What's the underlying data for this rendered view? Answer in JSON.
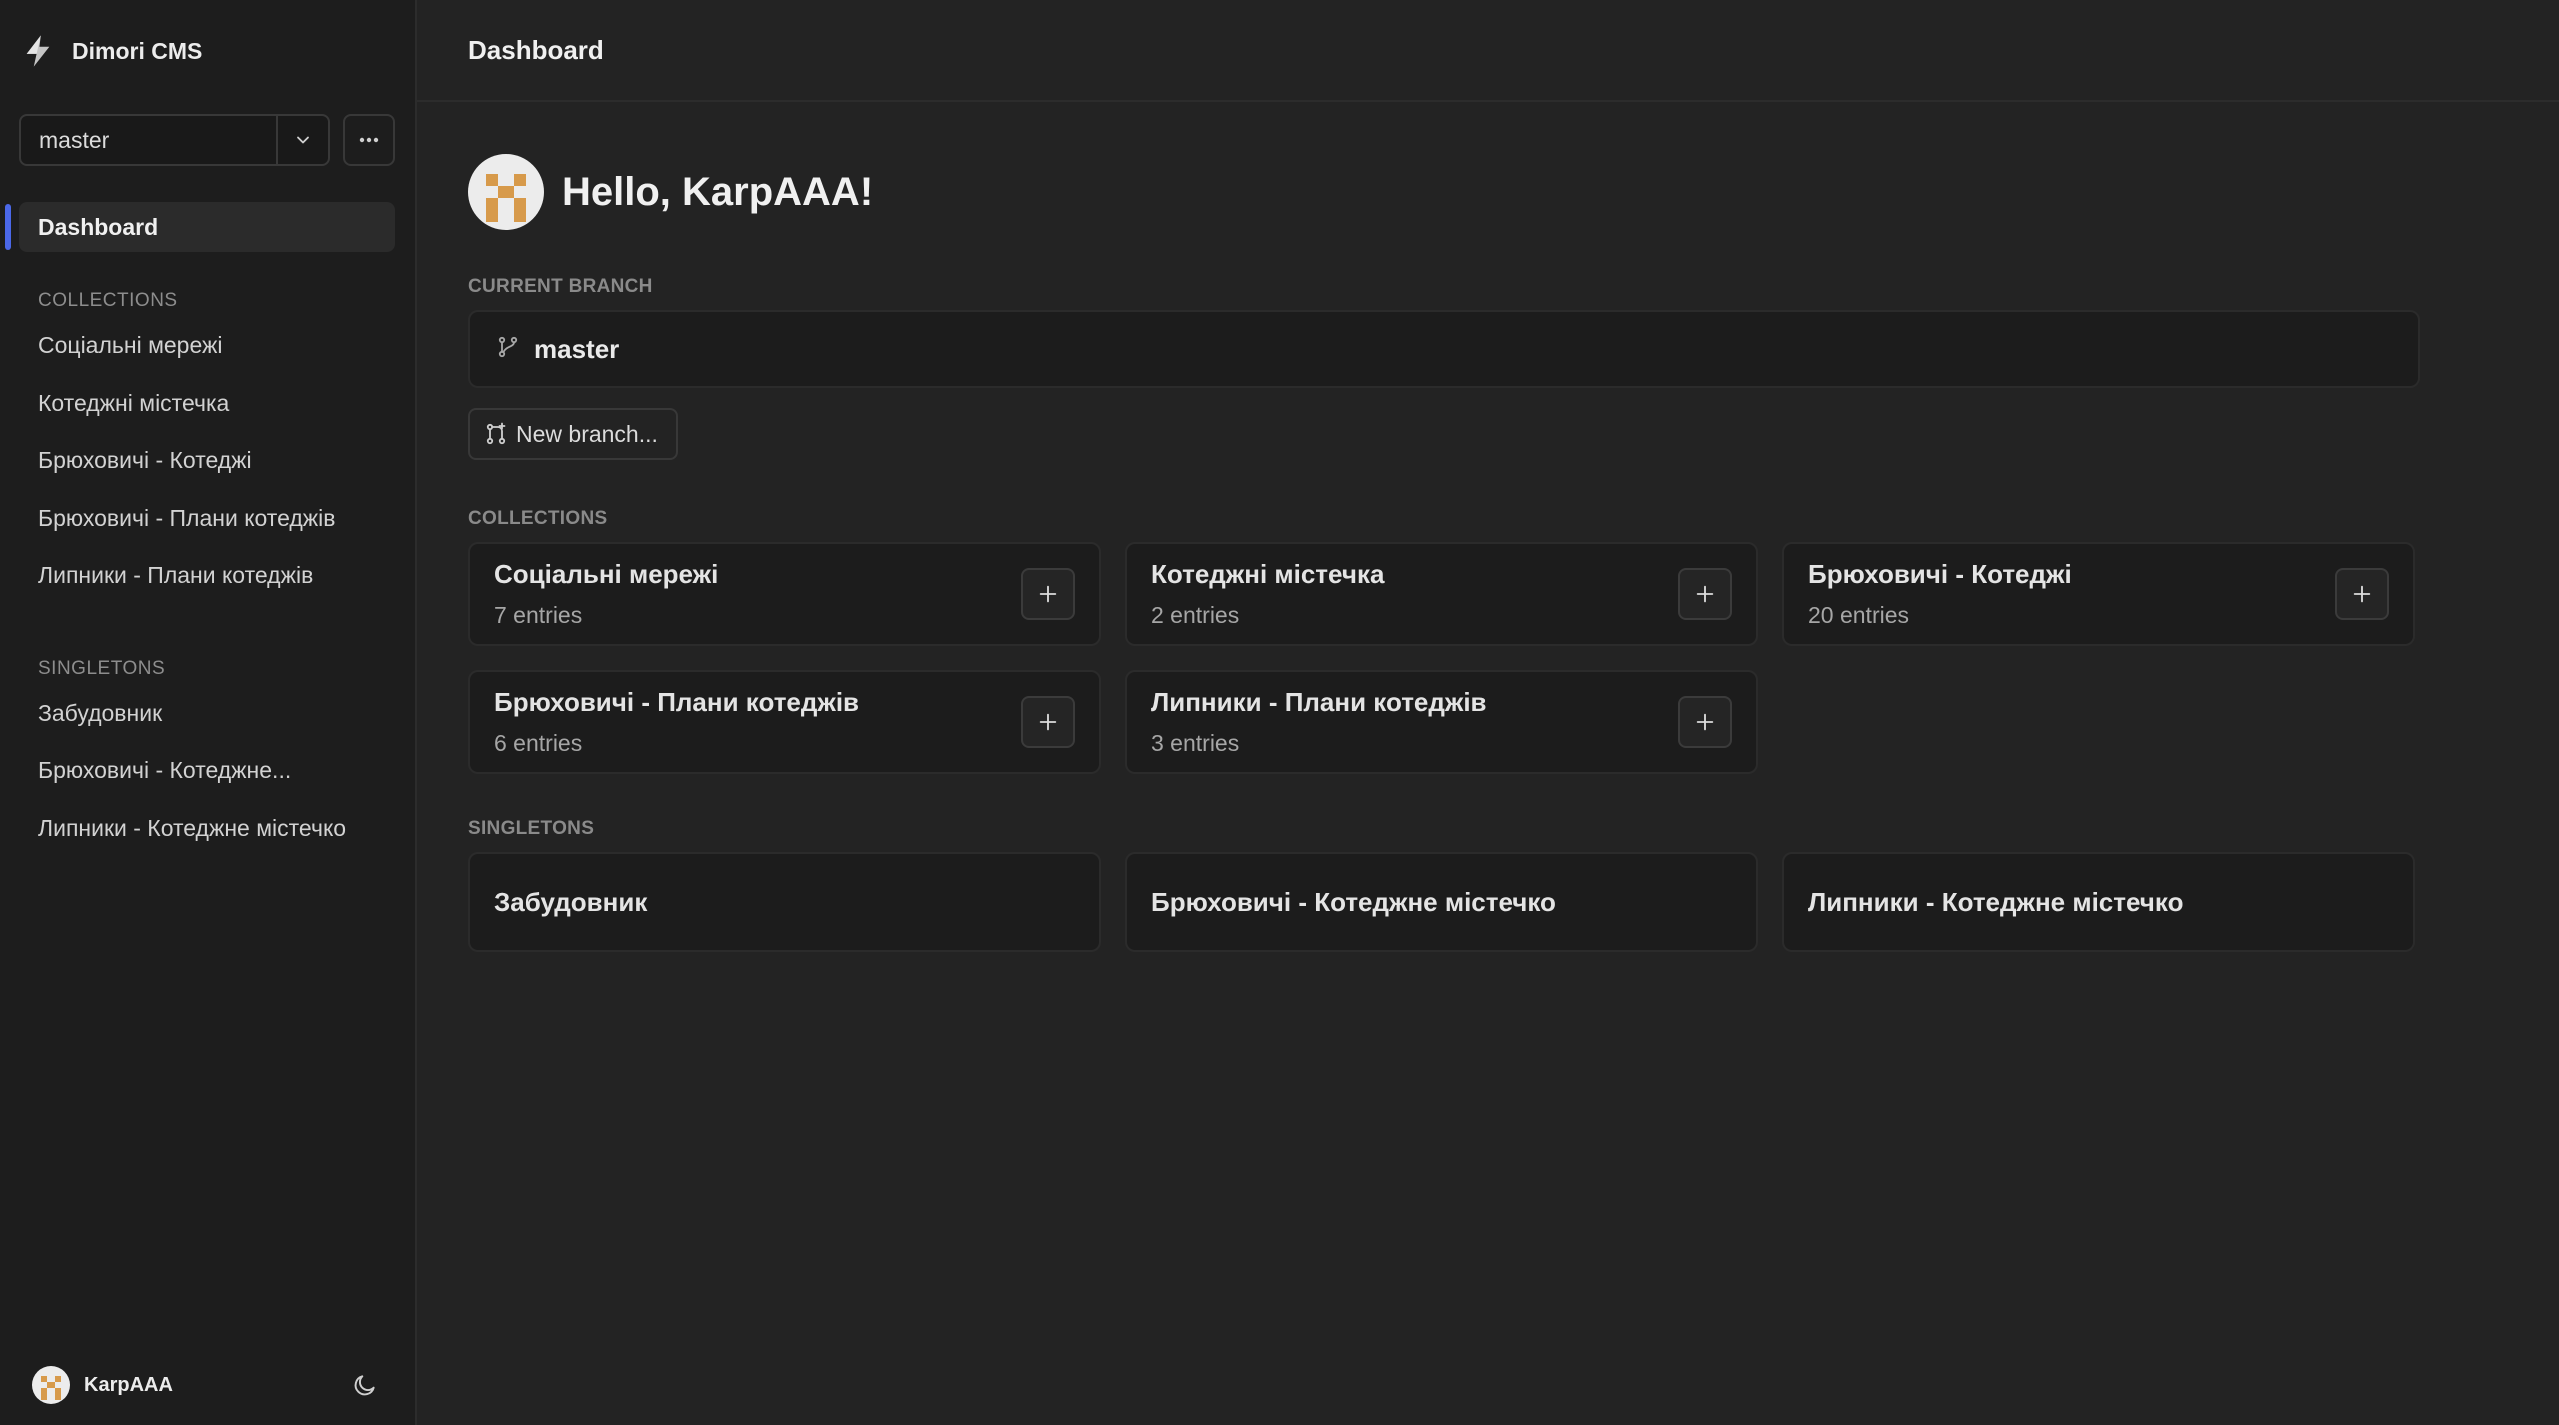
{
  "app": {
    "name": "Dimori CMS"
  },
  "branch_selector": {
    "value": "master"
  },
  "sidebar": {
    "active_item": "Dashboard",
    "collections_label": "COLLECTIONS",
    "collections": [
      "Соціальні мережі",
      "Котеджні містечка",
      "Брюховичі - Котеджі",
      "Брюховичі - Плани котеджів",
      "Липники - Плани котеджів"
    ],
    "singletons_label": "SINGLETONS",
    "singletons": [
      "Забудовник",
      "Брюховичі - Котеджне...",
      "Липники - Котеджне містечко"
    ]
  },
  "user": {
    "name": "KarpAAA"
  },
  "topbar": {
    "title": "Dashboard"
  },
  "main": {
    "greeting": "Hello, KarpAAA!",
    "current_branch_label": "CURRENT BRANCH",
    "current_branch": "master",
    "new_branch_label": "New branch...",
    "collections_label": "COLLECTIONS",
    "collections": [
      {
        "title": "Соціальні мережі",
        "entries": "7 entries"
      },
      {
        "title": "Котеджні містечка",
        "entries": "2 entries"
      },
      {
        "title": "Брюховичі - Котеджі",
        "entries": "20 entries"
      },
      {
        "title": "Брюховичі - Плани котеджів",
        "entries": "6 entries"
      },
      {
        "title": "Липники - Плани котеджів",
        "entries": "3 entries"
      }
    ],
    "singletons_label": "SINGLETONS",
    "singletons": [
      {
        "title": "Забудовник"
      },
      {
        "title": "Брюховичі - Котеджне містечко"
      },
      {
        "title": "Липники - Котеджне містечко"
      }
    ]
  },
  "icons": {
    "logo": "lightning-logo-icon",
    "chevron": "chevron-down-icon",
    "more": "ellipsis-icon",
    "branch": "git-branch-icon",
    "new_branch": "git-branch-plus-icon",
    "add": "plus-icon",
    "theme": "moon-icon"
  },
  "colors": {
    "accent": "#4b68e8",
    "background": "#232323",
    "sidebar": "#1d1d1d",
    "card": "#1c1c1c"
  }
}
